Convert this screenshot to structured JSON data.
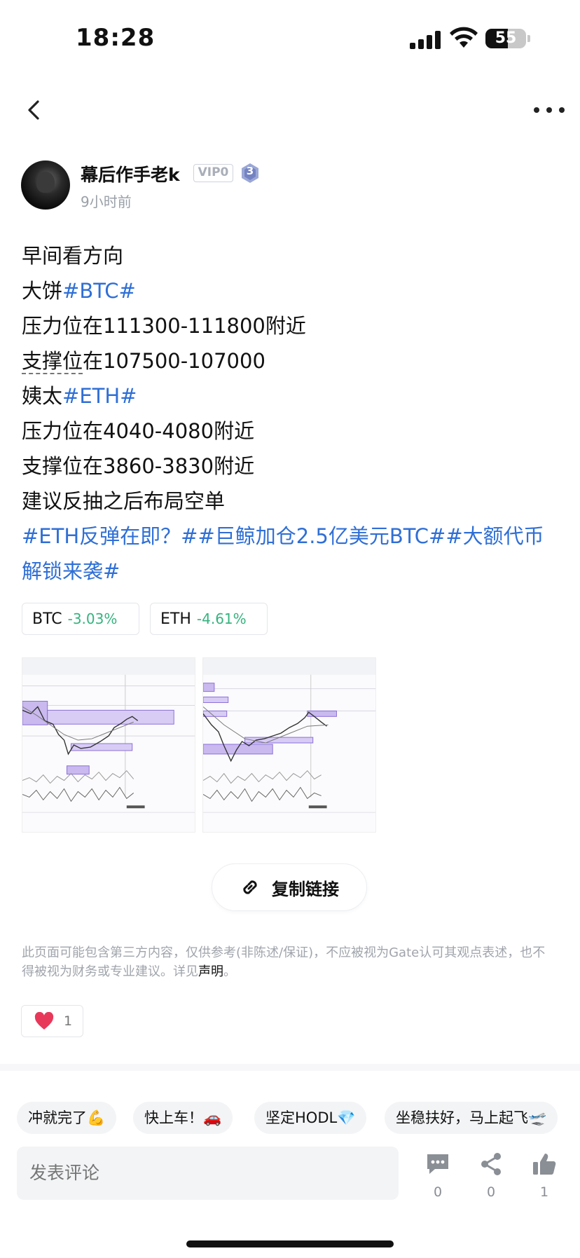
{
  "status_bar": {
    "time": "18:28",
    "battery": "55",
    "battery_level": 0.55
  },
  "author": {
    "name": "幕后作手老k",
    "vip": "VIP0",
    "level": "3",
    "time": "9小时前"
  },
  "post": {
    "lines": [
      {
        "text": "早间看方向"
      },
      {
        "prefix": "大饼",
        "tag": "#BTC#"
      },
      {
        "text": "压力位在111300-111800附近"
      },
      {
        "underlined": "支撑位",
        "rest": "在107500-107000"
      },
      {
        "prefix": "姨太",
        "tag": "#ETH#"
      },
      {
        "text": "压力位在4040-4080附近"
      },
      {
        "text": "支撑位在3860-3830附近"
      },
      {
        "text": "建议反抽之后布局空单"
      }
    ],
    "topics": "#ETH反弹在即？##巨鲸加仓2.5亿美元BTC##大额代币解锁来袭#"
  },
  "coins": [
    {
      "symbol": "BTC",
      "change": "-3.03%"
    },
    {
      "symbol": "ETH",
      "change": "-4.61%"
    }
  ],
  "copy_link_label": "复制链接",
  "disclaimer": {
    "text": "此页面可能包含第三方内容，仅供参考(非陈述/保证)，不应被视为Gate认可其观点表述，也不得被视为财务或专业建议。详见",
    "link": "声明",
    "end": "。"
  },
  "like": {
    "count": "1"
  },
  "quick_replies": [
    "冲就完了💪",
    "快上车！🚗",
    "坚定HODL💎",
    "坐稳扶好，马上起飞🛫"
  ],
  "comment": {
    "placeholder": "发表评论"
  },
  "actions": {
    "comments": "0",
    "shares": "0",
    "likes": "1"
  },
  "colors": {
    "tag": "#2f6fd6",
    "gain_loss": "#36b37e",
    "heart": "#e8385a"
  }
}
